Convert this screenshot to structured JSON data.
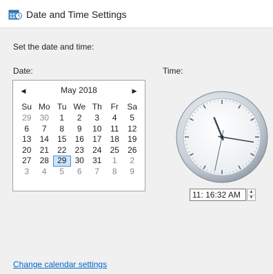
{
  "window": {
    "title": "Date and Time Settings",
    "icon": "date-time-settings-icon"
  },
  "prompt": "Set the date and time:",
  "date_label": "Date:",
  "time_label": "Time:",
  "calendar": {
    "prev_icon": "chevron-left-icon",
    "next_icon": "chevron-right-icon",
    "prev_glyph": "◀",
    "next_glyph": "▶",
    "month_title": "May 2018",
    "weekdays": [
      "Su",
      "Mo",
      "Tu",
      "We",
      "Th",
      "Fr",
      "Sa"
    ],
    "weeks": [
      [
        {
          "d": "29",
          "m": true
        },
        {
          "d": "30",
          "m": true
        },
        {
          "d": "1"
        },
        {
          "d": "2"
        },
        {
          "d": "3"
        },
        {
          "d": "4"
        },
        {
          "d": "5"
        }
      ],
      [
        {
          "d": "6"
        },
        {
          "d": "7"
        },
        {
          "d": "8"
        },
        {
          "d": "9"
        },
        {
          "d": "10"
        },
        {
          "d": "11"
        },
        {
          "d": "12"
        }
      ],
      [
        {
          "d": "13"
        },
        {
          "d": "14"
        },
        {
          "d": "15"
        },
        {
          "d": "16"
        },
        {
          "d": "17"
        },
        {
          "d": "18"
        },
        {
          "d": "19"
        }
      ],
      [
        {
          "d": "20"
        },
        {
          "d": "21"
        },
        {
          "d": "22"
        },
        {
          "d": "23"
        },
        {
          "d": "24"
        },
        {
          "d": "25"
        },
        {
          "d": "26"
        }
      ],
      [
        {
          "d": "27"
        },
        {
          "d": "28"
        },
        {
          "d": "29",
          "s": true
        },
        {
          "d": "30"
        },
        {
          "d": "31"
        },
        {
          "d": "1",
          "m": true
        },
        {
          "d": "2",
          "m": true
        }
      ],
      [
        {
          "d": "3",
          "m": true
        },
        {
          "d": "4",
          "m": true
        },
        {
          "d": "5",
          "m": true
        },
        {
          "d": "6",
          "m": true
        },
        {
          "d": "7",
          "m": true
        },
        {
          "d": "8",
          "m": true
        },
        {
          "d": "9",
          "m": true
        }
      ]
    ]
  },
  "clock": {
    "hour": 11,
    "minute": 16,
    "second": 32
  },
  "time_value": "11: 16:32 AM",
  "spinner": {
    "up_glyph": "▲",
    "down_glyph": "▼"
  },
  "link_text": "Change calendar settings",
  "colors": {
    "selected_day_bg": "#cce4f7",
    "selected_day_border": "#3d8ee0",
    "link": "#0066cc",
    "muted_day": "#8a8a8a"
  }
}
